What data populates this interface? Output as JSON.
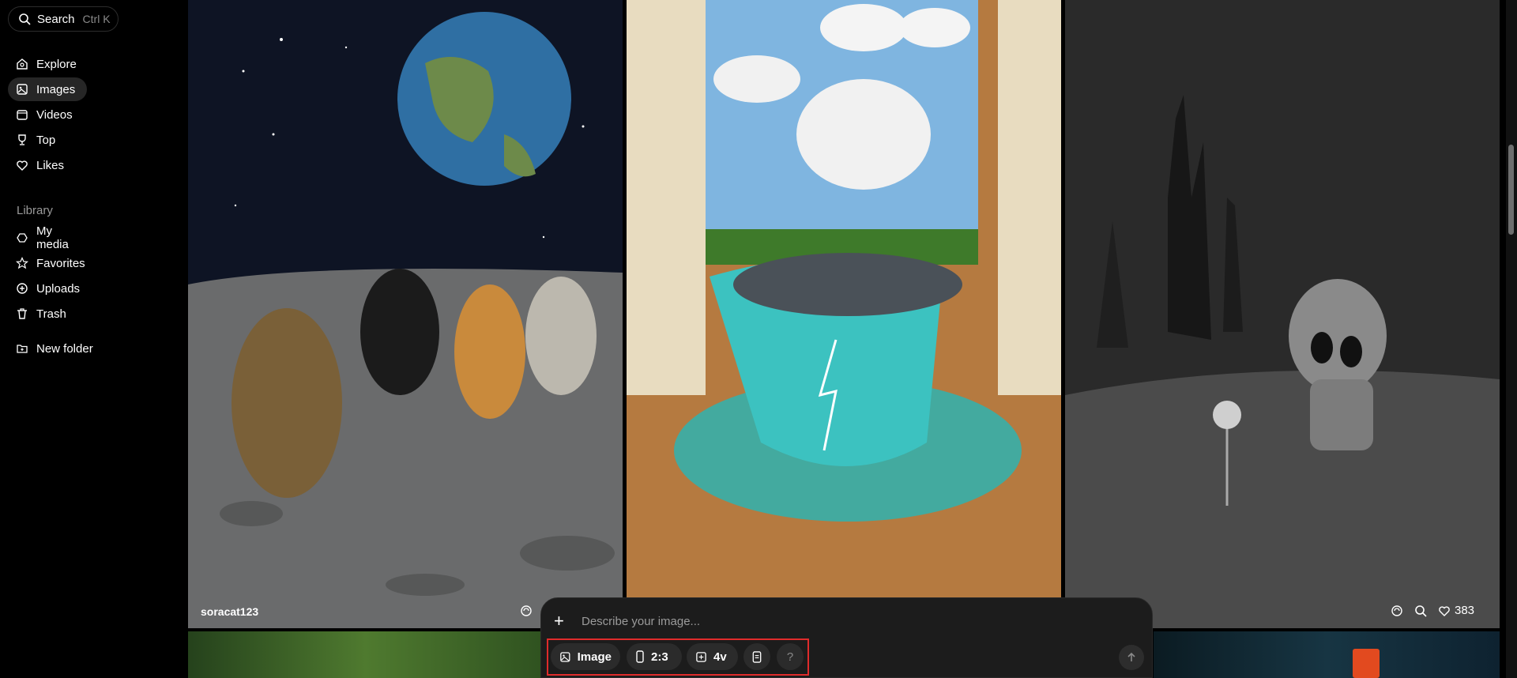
{
  "sidebar": {
    "search_label": "Search",
    "search_shortcut": "Ctrl K",
    "items": [
      {
        "label": "Explore",
        "icon": "compass-icon"
      },
      {
        "label": "Images",
        "icon": "image-icon"
      },
      {
        "label": "Videos",
        "icon": "video-icon"
      },
      {
        "label": "Top",
        "icon": "trophy-icon"
      },
      {
        "label": "Likes",
        "icon": "heart-icon"
      }
    ],
    "library_label": "Library",
    "library_items": [
      {
        "label": "My media",
        "icon": "media-icon"
      },
      {
        "label": "Favorites",
        "icon": "star-icon"
      },
      {
        "label": "Uploads",
        "icon": "upload-icon"
      },
      {
        "label": "Trash",
        "icon": "trash-icon"
      },
      {
        "label": "New folder",
        "icon": "folder-plus-icon"
      }
    ]
  },
  "gallery": {
    "tile1_author": "soracat123",
    "tile3_likes": "383"
  },
  "composer": {
    "placeholder": "Describe your image...",
    "mode_label": "Image",
    "ratio_label": "2:3",
    "variant_label": "4v",
    "help_label": "?"
  },
  "colors": {
    "background": "#000000",
    "panel": "#1c1c1c",
    "chip": "#2b2b2b",
    "highlight_box": "#e02b2b"
  }
}
